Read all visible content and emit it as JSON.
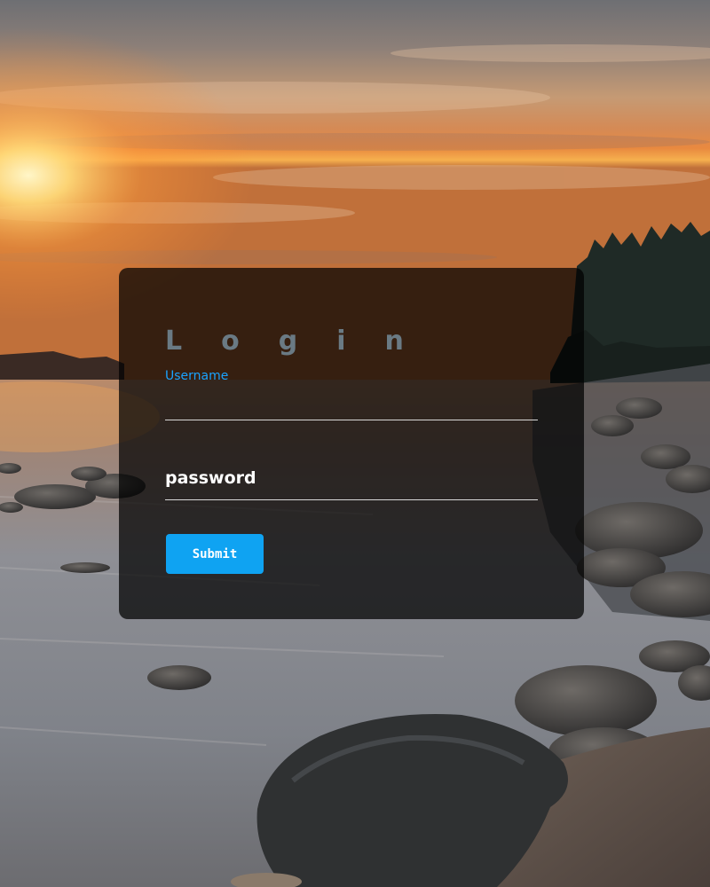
{
  "form": {
    "title": "Login",
    "username_label": "Username",
    "password_label": "password",
    "submit_label": "Submit"
  },
  "colors": {
    "accent": "#0fa3f2",
    "label_blue": "#1aa3ff",
    "card_bg": "rgba(0,0,0,0.72)",
    "field_line": "#d8d8d8"
  }
}
